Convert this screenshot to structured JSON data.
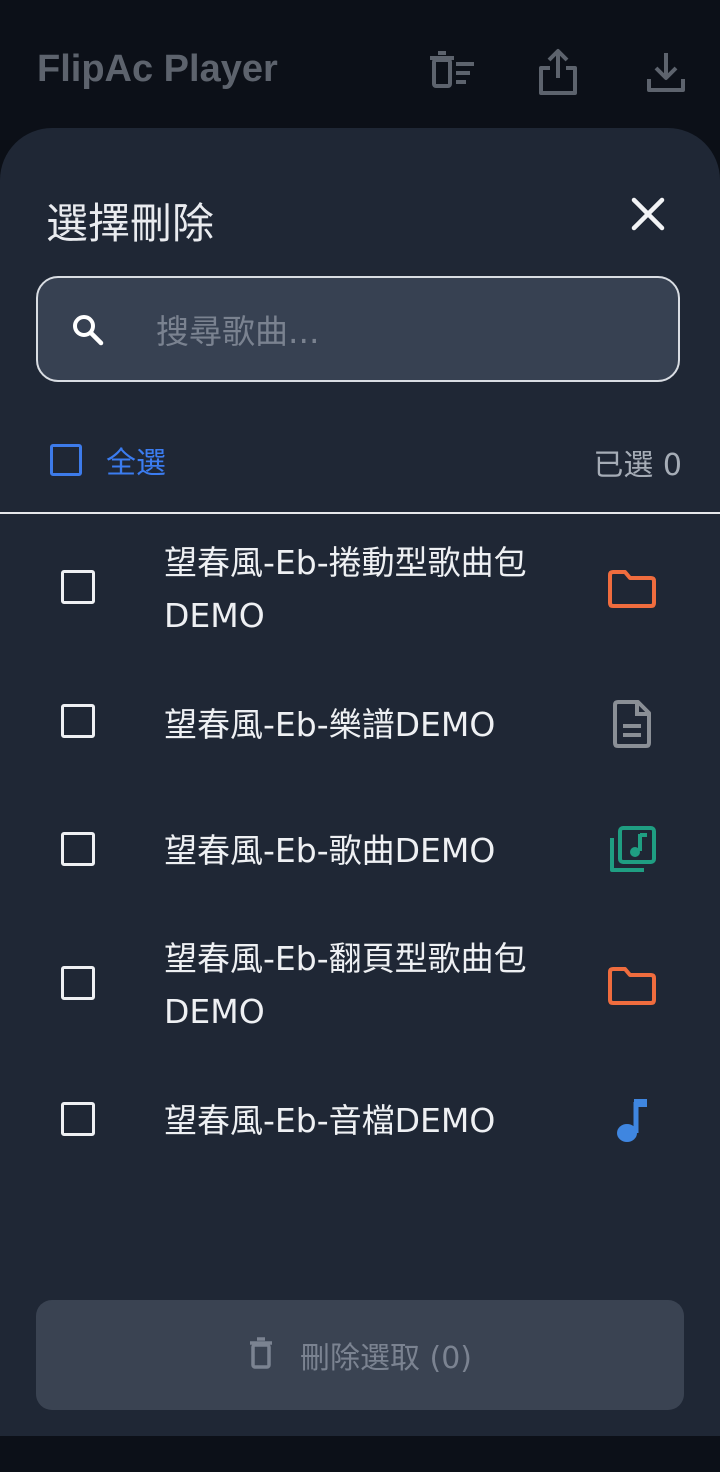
{
  "app": {
    "title": "FlipAc Player"
  },
  "toolbar": {
    "icons": [
      "delete-sweep-icon",
      "share-icon",
      "download-icon"
    ]
  },
  "sheet": {
    "title": "選擇刪除",
    "search": {
      "placeholder": "搜尋歌曲...",
      "value": ""
    },
    "select_all_label": "全選",
    "selected_count": "已選 0",
    "items": [
      {
        "label": "望春風-Eb-捲動型歌曲包DEMO",
        "type": "folder",
        "icon": "folder-icon",
        "color": "#ef6c3e",
        "checked": false
      },
      {
        "label": "望春風-Eb-樂譜DEMO",
        "type": "document",
        "icon": "document-icon",
        "color": "#8a8f96",
        "checked": false
      },
      {
        "label": "望春風-Eb-歌曲DEMO",
        "type": "song",
        "icon": "music-library-icon",
        "color": "#1f9e82",
        "checked": false
      },
      {
        "label": "望春風-Eb-翻頁型歌曲包DEMO",
        "type": "folder",
        "icon": "folder-icon",
        "color": "#ef6c3e",
        "checked": false
      },
      {
        "label": "望春風-Eb-音檔DEMO",
        "type": "audio",
        "icon": "music-note-icon",
        "color": "#3f86e0",
        "checked": false
      }
    ],
    "delete_button_label": "刪除選取 (0)"
  },
  "colors": {
    "accent": "#3b7cf0",
    "sheet_bg": "#1f2735",
    "app_bg": "#0c1018"
  }
}
